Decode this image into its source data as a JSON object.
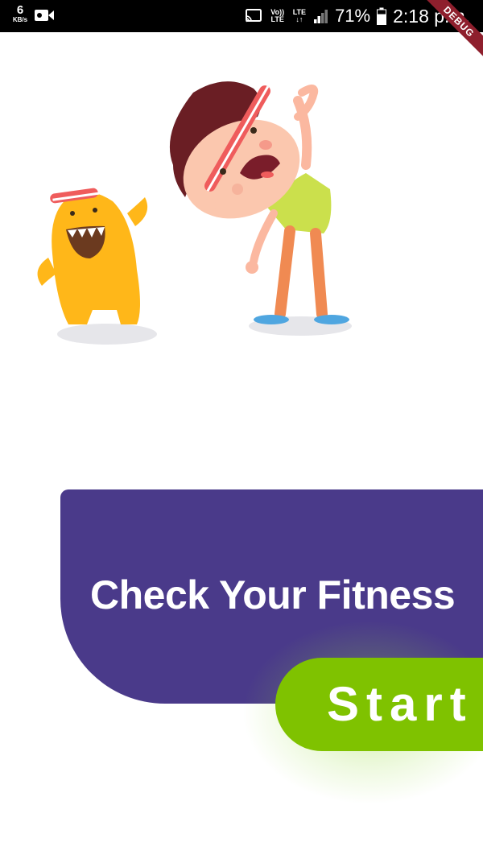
{
  "status_bar": {
    "net_speed_value": "6",
    "net_speed_unit": "KB/s",
    "volte_label": "Vo)) LTE",
    "lte_label": "LTE",
    "battery_percent": "71%",
    "time": "2:18 p.m.",
    "signal_bars_filled": 2,
    "signal_bars_total": 4,
    "battery_level": 0.71
  },
  "debug_banner": {
    "label": "DEBUG"
  },
  "hero": {
    "title": "Check Your Fitness",
    "start_label": "Start"
  },
  "colors": {
    "card": "#4a3a8a",
    "start_button": "#7fc200",
    "debug_banner": "#8e1f2d",
    "monster": "#ffb719",
    "boy_shirt": "#cbe04c",
    "boy_pants": "#f08a52",
    "boy_hair": "#6a1e24",
    "headband": "#ef5c5c"
  },
  "icons": [
    "video-camera-icon",
    "cast-icon",
    "signal-icon",
    "battery-icon"
  ]
}
